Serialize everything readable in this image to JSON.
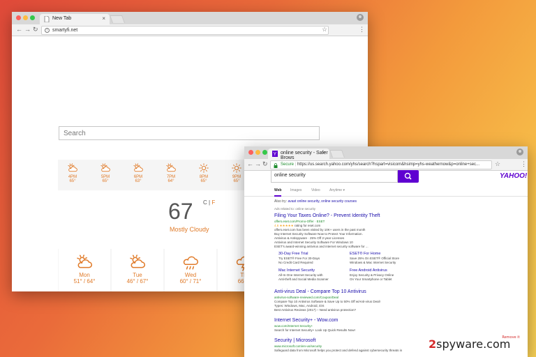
{
  "colors": {
    "accent_orange": "#e07a28",
    "yahoo_purple": "#5f01d1",
    "link_blue": "#1a0dab",
    "url_green": "#1e8c2e"
  },
  "window1": {
    "tab_title": "New Tab",
    "url": "smartyfi.net",
    "search_placeholder": "Search",
    "hourly": [
      {
        "time": "4PM",
        "temp": "65°",
        "icon": "partly-cloudy-icon"
      },
      {
        "time": "5PM",
        "temp": "65°",
        "icon": "partly-cloudy-icon"
      },
      {
        "time": "6PM",
        "temp": "63°",
        "icon": "partly-cloudy-icon"
      },
      {
        "time": "7PM",
        "temp": "64°",
        "icon": "partly-cloudy-icon"
      },
      {
        "time": "8PM",
        "temp": "65°",
        "icon": "sun-icon"
      },
      {
        "time": "9PM",
        "temp": "65°",
        "icon": "sun-icon"
      }
    ],
    "current_temp": "67",
    "unit_c": "C",
    "unit_sep": "|",
    "unit_f": "F",
    "condition": "Mostly Cloudy",
    "daily": [
      {
        "day": "Mon",
        "temps": "51° / 64°",
        "icon": "partly-cloudy-icon"
      },
      {
        "day": "Tue",
        "temps": "46° / 67°",
        "icon": "partly-cloudy-icon"
      },
      {
        "day": "Wed",
        "temps": "60° / 71°",
        "icon": "rain-icon"
      },
      {
        "day": "Th",
        "temps": "66° /",
        "icon": "storm-icon"
      }
    ]
  },
  "window2": {
    "tab_title": "online security - Safer Brows",
    "secure_label": "Secure",
    "url": "https://us.search.yahoo.com/yhs/search?hspart=visicom&hsimp=yhs-weathernow&p=online+sec...",
    "query": "online security",
    "logo": "YAHOO!",
    "tabs": [
      "Web",
      "Images",
      "Video",
      "Anytime ▾"
    ],
    "also_try_label": "Also try:",
    "also_try_links": "avast online security, online security courses",
    "ads_label": "Ads related to: online security",
    "results": [
      {
        "title": "Filing Your Taxes Online? - Prevent Identity Theft",
        "url": "offers.eset.com/Promo-Offer · ESET",
        "lines": [
          "rating for eset.com",
          "offers.eset.com has been visited by 10K+ users in the past month",
          "Buy Internet Security Software Now to Protect Your Information.",
          "Antivirus & Antispyware · 25% Off 2-year Licenses",
          "Antivirus and Internet Security Software For Windows 10",
          "ESET's award-winning antivirus and internet security software for ..."
        ],
        "stars": "4.6 ★★★★★",
        "sitelinks": [
          {
            "title": "30-Day Free Trial",
            "desc": [
              "Try ESET® Free For 30-Days",
              "No Credit Card Required"
            ]
          },
          {
            "title": "ESET® For Home",
            "desc": [
              "Save 25% On ESET® Official Store",
              "Windows & Mac Internet Security"
            ]
          },
          {
            "title": "Mac Internet Security",
            "desc": [
              "All-In-One Internet Security with",
              "Anti-theft and Social Media Scanner"
            ]
          },
          {
            "title": "Free Android Antivirus",
            "desc": [
              "Enjoy Security & Privacy Online",
              "On Your Smartphone or Tablet"
            ]
          }
        ]
      },
      {
        "title": "Anti-virus Deal - Compare Top 10 Antivirus",
        "url": "antivirus-software-reviewed.com/Coupon/Deal",
        "lines": [
          "Compare Top 10 Antivirus Software & Save Up to 50% Off w/Anti-virus Deal!",
          "Types: Windows, Mac, Android, iOS",
          "Best Antivirus Reviews (2017) – Need antivirus protection?"
        ]
      },
      {
        "title": "Internet Security+ - Wow.com",
        "url": "wow.com/Internet Security+",
        "lines": [
          "Search for Internet Security+ Look Up Quick Results Now!"
        ]
      },
      {
        "title": "Security | Microsoft",
        "url": "www.microsoft.com/en-us/security",
        "lines": [
          "Safeguard data from Microsoft helps you protect and defend against cybersecurity threats in"
        ]
      }
    ]
  },
  "watermark": {
    "two": "2",
    "text": "spyware.com",
    "sup": "Remove it"
  }
}
